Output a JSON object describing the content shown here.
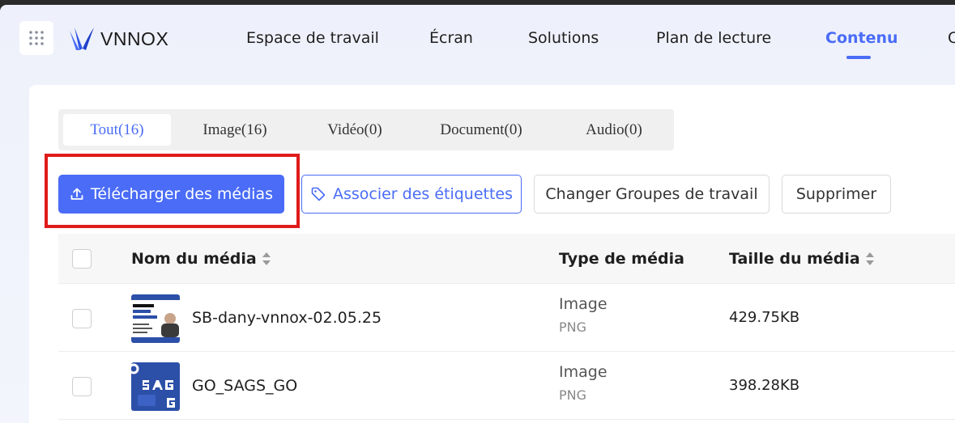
{
  "header": {
    "logo_text": "VNNOX",
    "nav": [
      {
        "label": "Espace de travail"
      },
      {
        "label": "Écran"
      },
      {
        "label": "Solutions"
      },
      {
        "label": "Plan de lecture"
      },
      {
        "label": "Contenu"
      },
      {
        "label": "C"
      }
    ],
    "active_nav": "Contenu",
    "accent_color": "#4a6cf7"
  },
  "filter_tabs": [
    {
      "label": "Tout(16)"
    },
    {
      "label": "Image(16)"
    },
    {
      "label": "Vidéo(0)"
    },
    {
      "label": "Document(0)"
    },
    {
      "label": "Audio(0)"
    }
  ],
  "toolbar": {
    "upload_label": "Télécharger des médias",
    "tags_label": "Associer des étiquettes",
    "change_groups_label": "Changer Groupes de travail",
    "delete_label": "Supprimer"
  },
  "table": {
    "columns": {
      "name": "Nom du média",
      "type": "Type de média",
      "size": "Taille du média"
    },
    "rows": [
      {
        "name": "SB-dany-vnnox-02.05.25",
        "type": "Image",
        "format": "PNG",
        "size": "429.75KB"
      },
      {
        "name": "GO_SAGS_GO",
        "type": "Image",
        "format": "PNG",
        "size": "398.28KB"
      }
    ]
  },
  "highlight_color": "#e01b1b"
}
